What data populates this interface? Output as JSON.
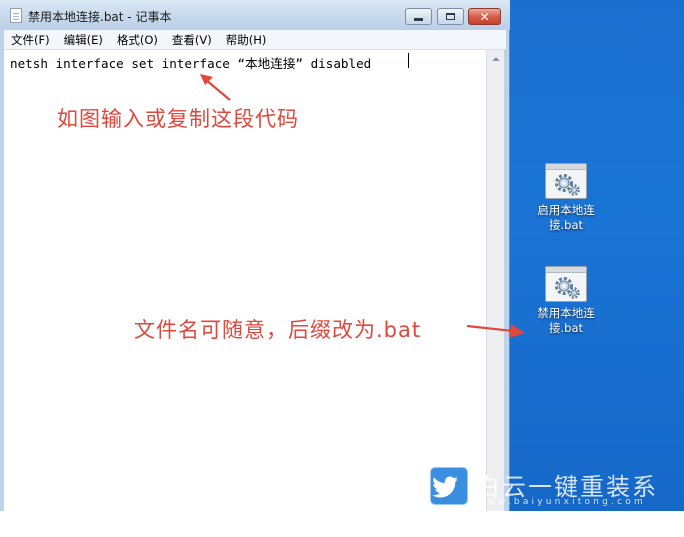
{
  "window": {
    "title": "禁用本地连接.bat - 记事本",
    "close_glyph": "✕"
  },
  "menu": {
    "items": [
      "文件(F)",
      "编辑(E)",
      "格式(O)",
      "查看(V)",
      "帮助(H)"
    ]
  },
  "editor": {
    "text": "netsh interface set interface “本地连接” disabled"
  },
  "annotations": {
    "input_hint": "如图输入或复制这段代码",
    "filename_hint": "文件名可随意，后缀改为.bat",
    "color": "#e0473d"
  },
  "desktop": {
    "icons": [
      {
        "label_line1": "启用本地连",
        "label_line2": "接.bat",
        "icon": "bat-gear-icon"
      },
      {
        "label_line1": "禁用本地连",
        "label_line2": "接.bat",
        "icon": "bat-gear-icon"
      }
    ],
    "background_color": "#1a74d6"
  },
  "watermark": {
    "title": "白云一键重装系统",
    "url": "www.baiyunxitong.com",
    "icon": "twitter-bird-icon"
  }
}
